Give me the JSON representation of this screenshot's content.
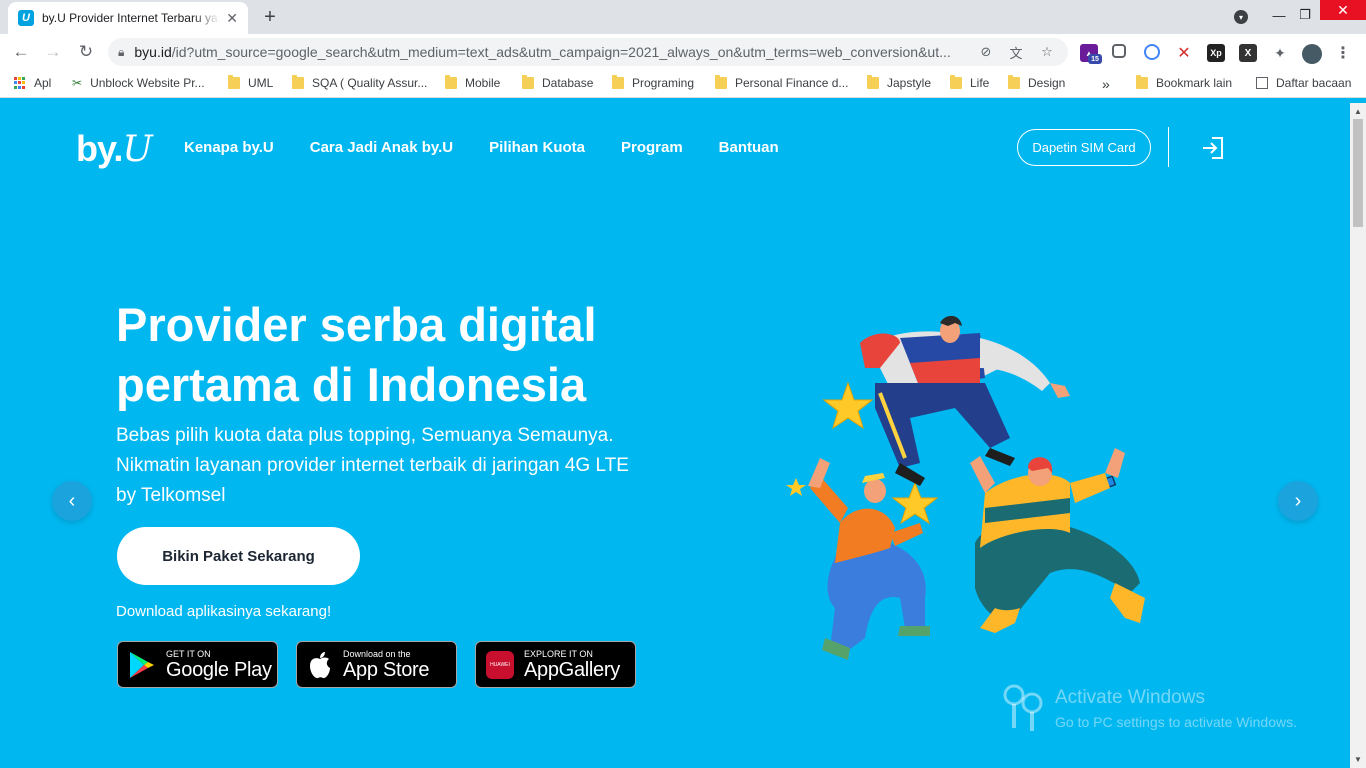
{
  "browser": {
    "tab_title": "by.U Provider Internet Terbaru yang Serba Digital",
    "tab_favicon": "U",
    "url_host": "byu.id",
    "url_path": "/id?utm_source=google_search&utm_medium=text_ads&utm_campaign=2021_always_on&utm_terms=web_conversion&ut...",
    "extension_badge": "15",
    "bookmarks": [
      "Apl",
      "Unblock Website Pr...",
      "UML",
      "SQA ( Quality Assur...",
      "Mobile",
      "Database",
      "Programing",
      "Personal Finance  d...",
      "Japstyle",
      "Life",
      "Design",
      "Bookmark lain",
      "Daftar bacaan"
    ],
    "bookmarks_overflow": "»"
  },
  "site": {
    "logo": "by.",
    "logo_u": "U",
    "nav": [
      "Kenapa by.U",
      "Cara Jadi Anak by.U",
      "Pilihan Kuota",
      "Program",
      "Bantuan"
    ],
    "sim_button": "Dapetin SIM Card"
  },
  "hero": {
    "title": "Provider serba digital pertama di Indonesia",
    "subtitle": "Bebas pilih kuota data plus topping, Semuanya Semaunya. Nikmatin layanan provider internet terbaik di jaringan 4G LTE by Telkomsel",
    "cta": "Bikin Paket Sekarang",
    "download_text": "Download aplikasinya sekarang!",
    "stores": [
      {
        "small": "GET IT ON",
        "big": "Google Play",
        "icon": "google-play-icon"
      },
      {
        "small": "Download on the",
        "big": "App Store",
        "icon": "apple-icon"
      },
      {
        "small": "EXPLORE IT ON",
        "big": "AppGallery",
        "icon": "huawei-icon",
        "icon_text": "HUAWEI"
      }
    ]
  },
  "watermark": {
    "title": "Activate Windows",
    "subtitle": "Go to PC settings to activate Windows."
  },
  "colors": {
    "hero_bg": "#01b7f0",
    "arrow_bg": "#1aa3dd"
  }
}
